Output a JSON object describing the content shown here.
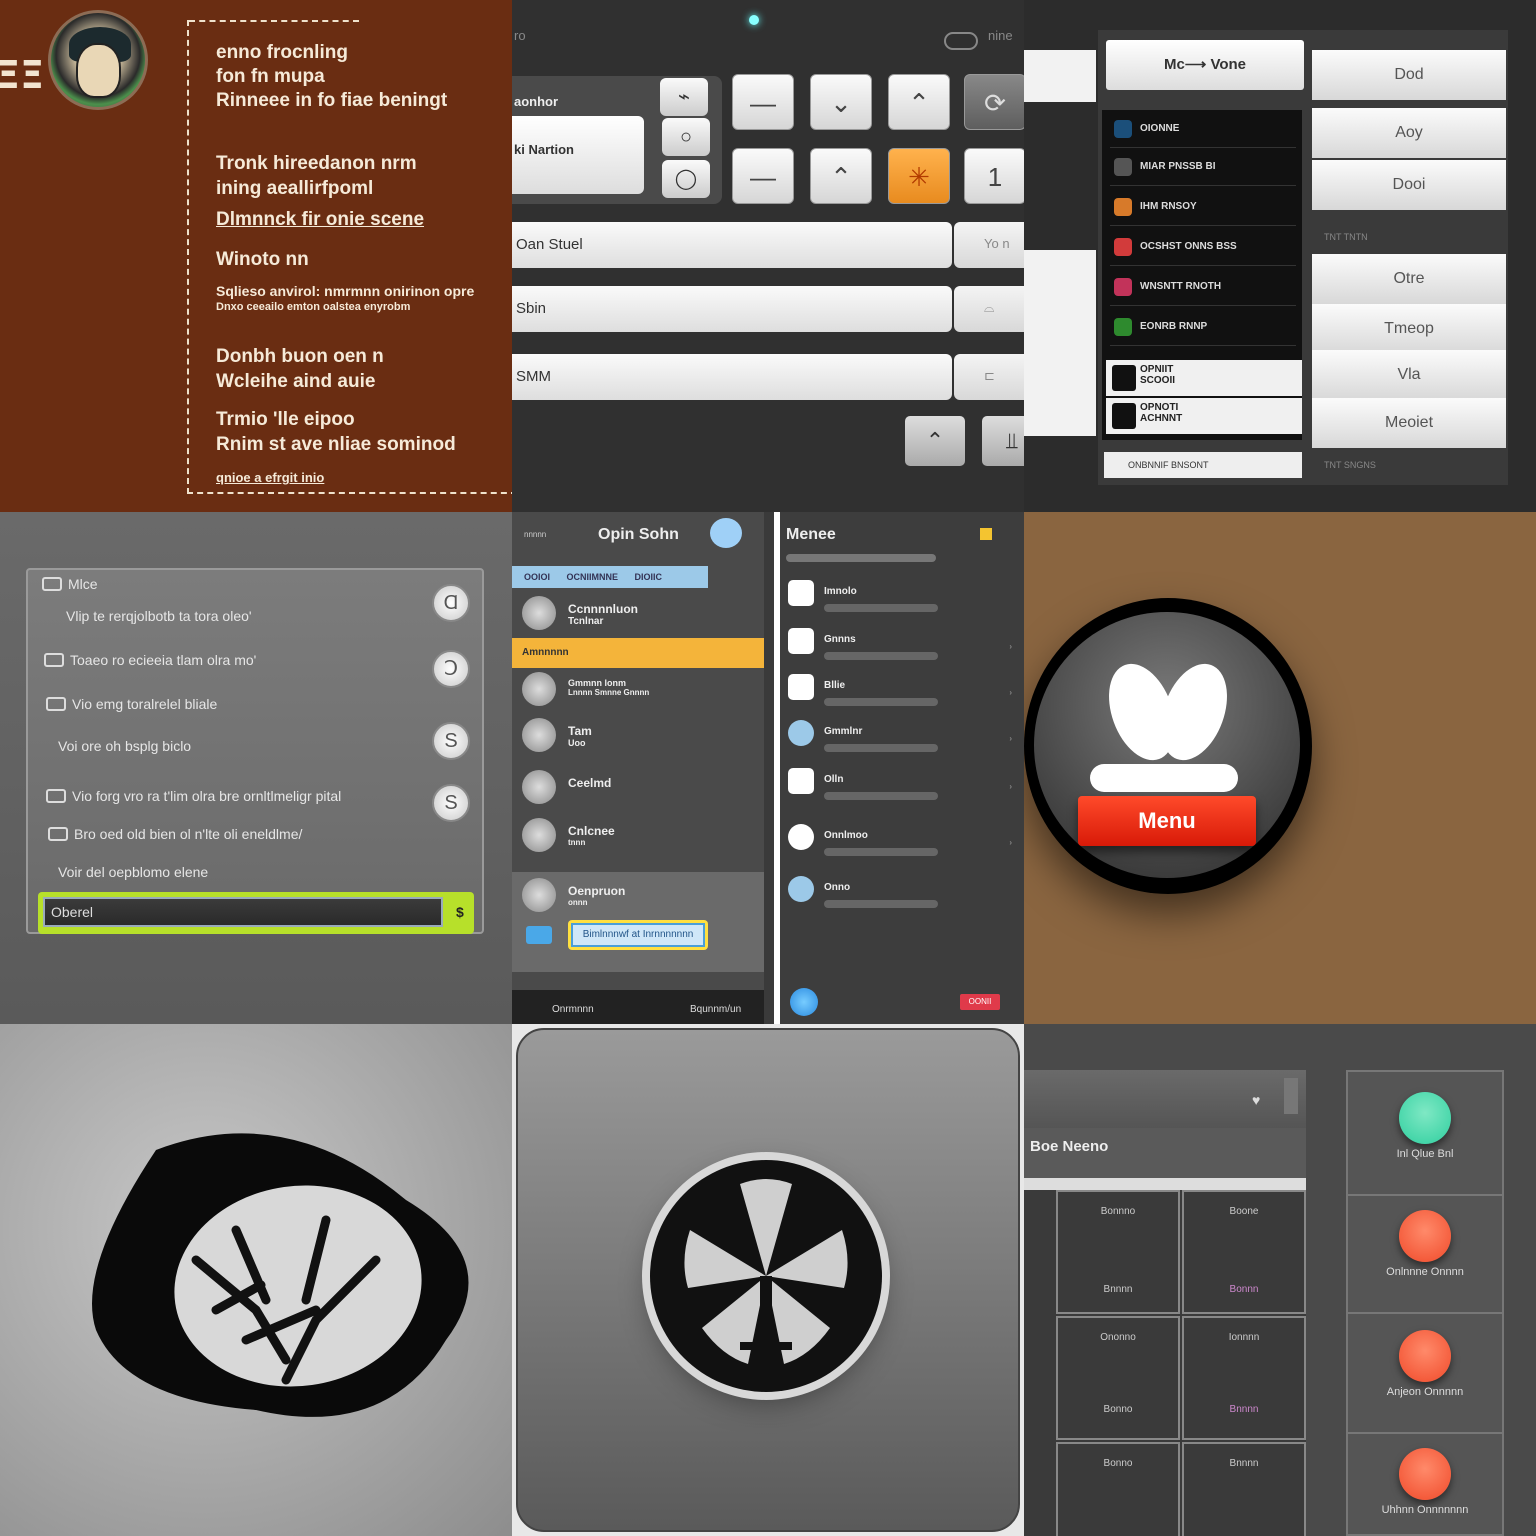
{
  "colors": {
    "orange_key": "#e88b1f",
    "menu_red": "#e0220f",
    "lime": "#b7e02a",
    "accent_blue": "#9cc9e8",
    "yellow": "#f4b43a",
    "teal": "#2fcf9f"
  },
  "tile1": {
    "side_glyph": "ΞΞ",
    "lines": [
      "enno frocnling",
      "fon fn mupa",
      "Rinneee in fo fiae beningt",
      "Tronk hireedanon nrm",
      "ining aeallirfpoml",
      "Dlmnnck fir onie scene",
      "Winoto nn",
      "Sqlieso anvirol: nmrmnn onirinon opre",
      "Dnxo ceeailo emton oalstea enyrobm",
      "Donbh buon oen n",
      "Wcleihe aind auie",
      "Trmio 'lle eipoo",
      "Rnim st ave nliae sominod",
      "qnioe a efrgit inio"
    ]
  },
  "tile2": {
    "top_left": "ro",
    "top_right": "nine",
    "panel_label": "aonhor",
    "card_label": "ki Nartion",
    "keys_row1": [
      "—",
      "⌄",
      "⌃",
      "⟳"
    ],
    "keys_row2": [
      "—",
      "⌃",
      "✳",
      "1"
    ],
    "bars": [
      {
        "label": "Oan Stuel",
        "right": "Yo n"
      },
      {
        "label": "Sbin",
        "right": "⌓"
      },
      {
        "label": "SMM",
        "right": "⊏"
      }
    ],
    "small_keys": [
      "⌃",
      "⫫"
    ]
  },
  "tile3": {
    "header": "Mc⟶ Vone",
    "list": [
      "OIONNE",
      "MIAR PNSSB BI",
      "IHM RNSOY",
      "OCSHST ONNS BSS",
      "WNSNTT RNOTH",
      "EONRB RNNP"
    ],
    "cards": [
      [
        "OPNIIT",
        "SCOOII"
      ],
      [
        "OPNOTI",
        "ACHNNT"
      ]
    ],
    "footer": "ONBNNIF BNSONT",
    "buttons_top": [
      "Dod",
      "Aoy",
      "Dooi"
    ],
    "sep1": "TNT TNTN",
    "buttons_bottom": [
      "Otre",
      "Tmeop",
      "Vla",
      "Meoiet"
    ],
    "sep2": "TNT SNGNS"
  },
  "tile4": {
    "rows": [
      "Mlce",
      "Vlip te rerqjolbotb ta tora oleo'",
      "Toaeo ro ecieeia tlam olra mo'",
      "Vio emg toralrelel bliale",
      "Voi ore oh bsplg biclo",
      "Vio forg vro ra t'lim olra bre ornltlmeligr pital",
      "Bro oed old bien ol n'lte oli eneldlme/",
      "Voir del oepblomo elene"
    ],
    "round_icons": [
      "Ɑ",
      "Ↄ",
      "S",
      "S"
    ],
    "input_value": "Oberel",
    "input_icon": "$"
  },
  "tile5": {
    "left_title": "Opin Sohn",
    "left_small": "nnnnn",
    "tabs": "OOIOI OCNIIMNNE DIOIIC",
    "items": [
      {
        "label": "Ccnnnnluon",
        "sub": "Tcnlnar"
      },
      {
        "label": "Amnnnnn",
        "sub": ""
      },
      {
        "label": "Gmmnn lonm",
        "sub": "Lnnnn Smnne Gnnnn"
      },
      {
        "label": "Tam",
        "sub": "Uoo"
      },
      {
        "label": "Ceelmd",
        "sub": ""
      },
      {
        "label": "Cnlcnee",
        "sub": "tnnn"
      },
      {
        "label": "Oenpruon",
        "sub": "onnn"
      }
    ],
    "highlight_button": "Bimlnnnwf at Inrnnnnnnn",
    "bottom_left": "Onrmnnn",
    "bottom_right": "Bqunnm/un",
    "right_title": "Menee",
    "right_items": [
      "Imnolo",
      "Gnnns",
      "Bllie",
      "Gmmlnr",
      "Olln",
      "Onnlmoo",
      "Onno"
    ],
    "red_tag": "OONII"
  },
  "tile6": {
    "button_label": "Menu"
  },
  "tile9": {
    "title": "Boe Neeno",
    "cells": [
      [
        "Bonnno",
        "Boone"
      ],
      [
        "Bnnnn",
        "Bonnn"
      ],
      [
        "Ononno",
        "Ionnnn"
      ],
      [
        "Bonno",
        "Bnnnn"
      ],
      [
        "Bonno",
        "Bnnnn"
      ]
    ],
    "right_items": [
      {
        "label": "Inl Qlue Bnl",
        "color": "#2fcf9f"
      },
      {
        "label": "Onlnnne Onnnn",
        "color": "#f04a2a"
      },
      {
        "label": "Anjeon Onnnnn",
        "color": "#f04a2a"
      },
      {
        "label": "Uhhnn Onnnnnnn",
        "color": "#f04a2a"
      }
    ]
  }
}
